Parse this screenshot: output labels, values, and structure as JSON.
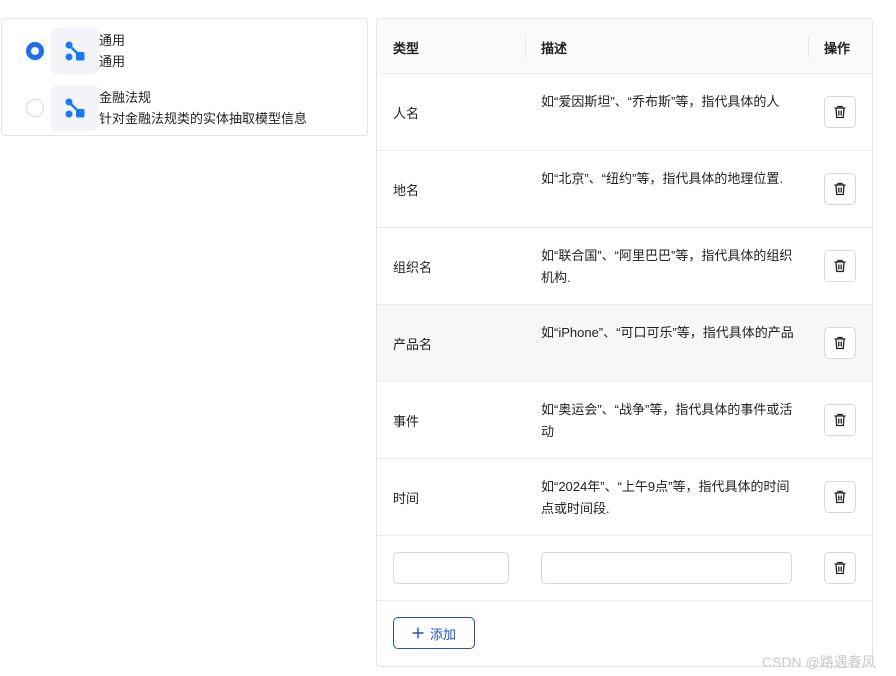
{
  "templates": [
    {
      "title": "通用",
      "description": "通用",
      "selected": true,
      "icon": "node-graph-icon"
    },
    {
      "title": "金融法规",
      "description": "针对金融法规类的实体抽取模型信息",
      "selected": false,
      "icon": "node-graph-icon"
    }
  ],
  "table": {
    "headers": {
      "type": "类型",
      "description": "描述",
      "action": "操作"
    },
    "rows": [
      {
        "type": "人名",
        "description": "如“爱因斯坦”、“乔布斯”等，指代具体的人"
      },
      {
        "type": "地名",
        "description": "如“北京”、“纽约”等，指代具体的地理位置."
      },
      {
        "type": "组织名",
        "description": "如“联合国”、“阿里巴巴”等，指代具体的组织机构."
      },
      {
        "type": "产品名",
        "description": "如“iPhone”、“可口可乐”等，指代具体的产品"
      },
      {
        "type": "事件",
        "description": "如“奥运会”、“战争”等，指代具体的事件或活动"
      },
      {
        "type": "时间",
        "description": "如“2024年”、“上午9点”等，指代具体的时间点或时间段."
      }
    ],
    "new_row": {
      "type_value": "",
      "description_value": ""
    },
    "add_label": "添加",
    "delete_icon": "trash-icon"
  },
  "colors": {
    "accent": "#1d6ff2",
    "add_button": "#1d4fd8",
    "icon": "#1677ff"
  },
  "watermark": "CSDN @路遇春风"
}
